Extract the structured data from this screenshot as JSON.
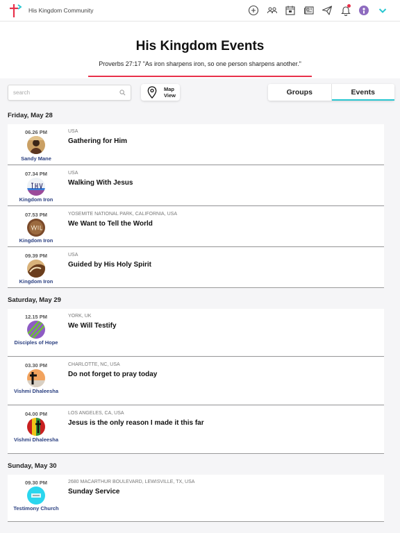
{
  "app": {
    "title": "His Kingdom Community"
  },
  "topbar": {
    "icons": [
      "add-circle-icon",
      "people-icon",
      "calendar-icon",
      "newspaper-icon",
      "send-icon",
      "bell-icon",
      "profile-icon",
      "chevron-down-icon"
    ],
    "accent_color": "#26c6d0",
    "notification_color": "#e8304a"
  },
  "hero": {
    "title": "His Kingdom Events",
    "verse": "Proverbs 27:17 \"As iron sharpens iron, so one person sharpens another.\""
  },
  "search": {
    "placeholder": "search",
    "value": ""
  },
  "map_view": {
    "line1": "Map",
    "line2": "View"
  },
  "tabs": [
    {
      "label": "Groups",
      "active": false
    },
    {
      "label": "Events",
      "active": true
    }
  ],
  "days": [
    {
      "date": "Friday, May 28",
      "events": [
        {
          "time": "06.26 PM",
          "organizer": "Sandy Mane",
          "location": "USA",
          "name": "Gathering for Him"
        },
        {
          "time": "07.34 PM",
          "organizer": "Kingdom Iron",
          "location": "USA",
          "name": "Walking With Jesus"
        },
        {
          "time": "07.53 PM",
          "organizer": "Kingdom Iron",
          "location": "YOSEMITE NATIONAL PARK, CALIFORNIA, USA",
          "name": "We Want to Tell the World"
        },
        {
          "time": "09.39 PM",
          "organizer": "Kingdom Iron",
          "location": "USA",
          "name": "Guided by His Holy Spirit"
        }
      ]
    },
    {
      "date": "Saturday, May 29",
      "events": [
        {
          "time": "12.15 PM",
          "organizer": "Disciples of Hope",
          "location": "YORK, UK",
          "name": "We Will Testify"
        },
        {
          "time": "03.30 PM",
          "organizer": "Vishmi Dhaleesha",
          "location": "CHARLOTTE, NC, USA",
          "name": "Do not forget to pray today"
        },
        {
          "time": "04.00 PM",
          "organizer": "Vishmi Dhaleesha",
          "location": "LOS ANGELES, CA, USA",
          "name": "Jesus is the only reason I made it this far"
        }
      ]
    },
    {
      "date": "Sunday, May 30",
      "events": [
        {
          "time": "09.30 PM",
          "organizer": "Testimony Church",
          "location": "2680 MACARTHUR BOULEVARD, LEWISVILLE, TX, USA",
          "name": "Sunday Service"
        }
      ]
    }
  ]
}
